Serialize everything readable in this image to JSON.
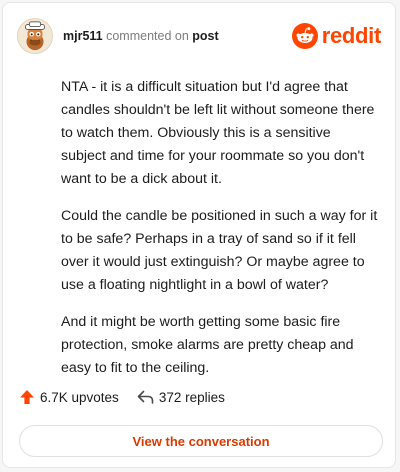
{
  "header": {
    "username": "mjr511",
    "action_text": "commented on",
    "post_link": "post"
  },
  "brand": {
    "icon": "reddit-alien-icon",
    "wordmark": "reddit",
    "color": "#ff4500"
  },
  "comment": {
    "paragraphs": [
      "NTA - it is a difficult situation but I'd agree that candles shouldn't be left lit without someone there to watch them. Obviously this is a sensitive subject and time for your roommate so you don't want to be a dick about it.",
      "Could the candle be positioned in such a way for it to be safe? Perhaps in a tray of sand so if it fell over it would just extinguish? Or maybe agree to use a floating nightlight in a bowl of water?",
      "And it might be worth getting some basic fire protection, smoke alarms are pretty cheap and easy to fit to the ceiling."
    ]
  },
  "stats": {
    "upvotes": "6.7K upvotes",
    "replies": "372 replies",
    "upvote_icon": "upvote-arrow-icon",
    "reply_icon": "reply-arrow-icon"
  },
  "cta": {
    "label": "View the conversation",
    "color": "#d93a00"
  }
}
